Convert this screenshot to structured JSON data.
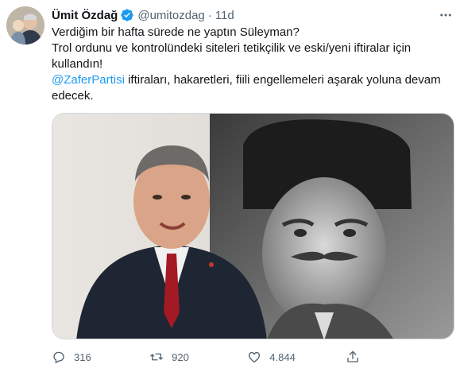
{
  "user": {
    "name": "Ümit Özdağ",
    "handle": "@umitozdag",
    "separator": "·",
    "time": "11d",
    "verified_icon": "verified-badge-icon"
  },
  "tweet": {
    "line1": "Verdiğim bir hafta sürede ne yaptın Süleyman?",
    "line2": "Trol ordunu ve kontrolündeki siteleri tetikçilik ve eski/yeni iftiralar için kullandın!",
    "mention": "@ZaferPartisi",
    "line3_rest": " iftiraları, hakaretleri, fiili engellemeleri aşarak yoluna devam edecek."
  },
  "actions": {
    "reply_count": "316",
    "retweet_count": "920",
    "like_count": "4.844"
  },
  "colors": {
    "accent": "#1d9bf0",
    "text": "#0f1419",
    "secondary": "#536471"
  }
}
